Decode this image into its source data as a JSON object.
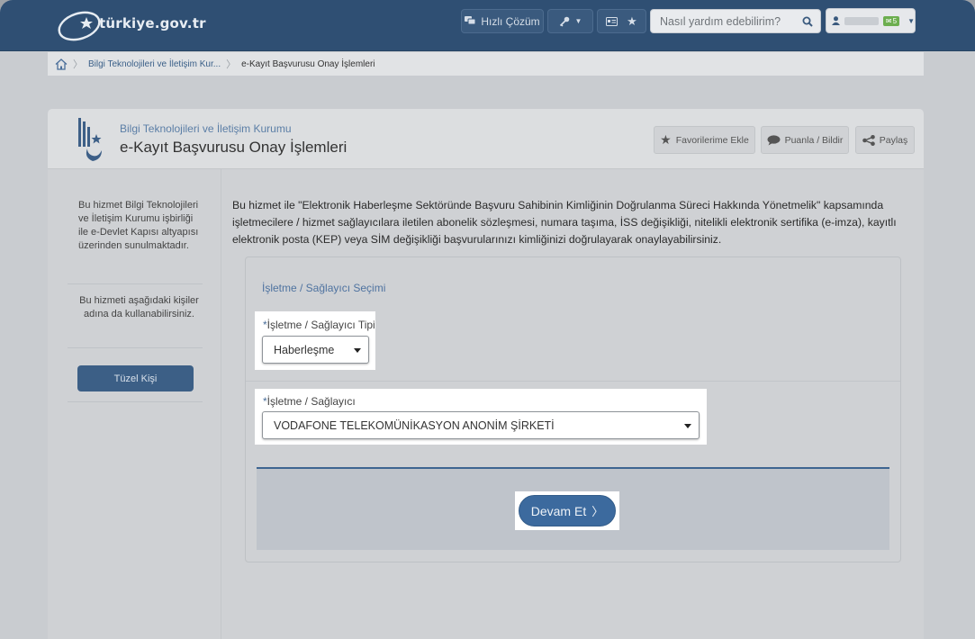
{
  "header": {
    "logo_text": "türkiye.gov.tr",
    "quick_solution_label": "Hızlı Çözüm",
    "search_placeholder": "Nasıl yardım edebilirim?",
    "mail_badge": "5",
    "colors": {
      "bar": "#2f4f73",
      "accent": "#3c6a9e"
    }
  },
  "breadcrumb": {
    "items": [
      "Bilgi Teknolojileri ve İletişim Kur...",
      "e-Kayıt Başvurusu Onay İşlemleri"
    ]
  },
  "page": {
    "institution": "Bilgi Teknolojileri ve İletişim Kurumu",
    "title": "e-Kayıt Başvurusu Onay İşlemleri",
    "actions": {
      "favorite": "Favorilerime Ekle",
      "rate": "Puanla / Bildir",
      "share": "Paylaş"
    }
  },
  "sidebar": {
    "text1": "Bu hizmet Bilgi Teknolojileri ve İletişim Kurumu işbirliği ile e-Devlet Kapısı altyapısı üzerinden sunulmaktadır.",
    "text2": "Bu hizmeti aşağıdaki kişiler adına da kullanabilirsiniz.",
    "button": "Tüzel Kişi"
  },
  "content": {
    "description": "Bu hizmet ile \"Elektronik Haberleşme Sektöründe Başvuru Sahibinin Kimliğinin Doğrulanma Süreci Hakkında Yönetmelik\" kapsamında işletmecilere / hizmet sağlayıcılara iletilen abonelik sözleşmesi, numara taşıma, İSS değişikliği, nitelikli elektronik sertifika (e-imza), kayıtlı elektronik posta (KEP) veya SİM değişikliği başvurularınızı kimliğinizi doğrulayarak onaylayabilirsiniz.",
    "panel_title": "İşletme / Sağlayıcı Seçimi",
    "type_label": "İşletme / Sağlayıcı Tipi",
    "type_value": "Haberleşme",
    "provider_label": "İşletme / Sağlayıcı",
    "provider_value": "VODAFONE TELEKOMÜNİKASYON ANONİM ŞİRKETİ",
    "required_mark": "*",
    "continue_button": "Devam Et"
  }
}
